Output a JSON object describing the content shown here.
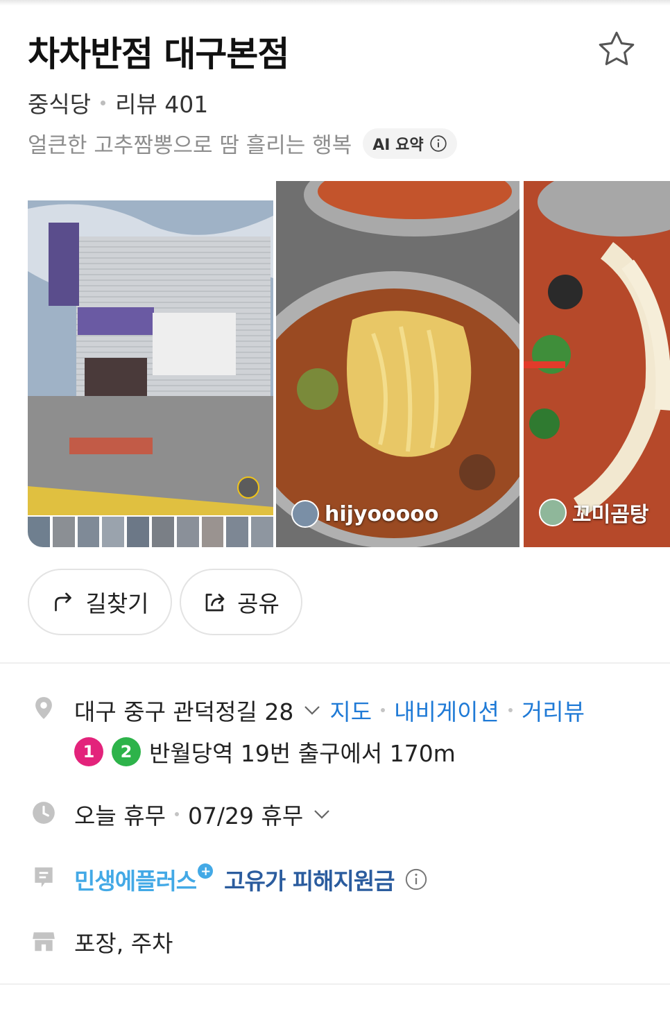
{
  "place": {
    "name": "차차반점 대구본점",
    "category": "중식당",
    "review_label": "리뷰 401",
    "summary": "얼큰한 고추짬뽕으로 땀 흘리는 행복",
    "ai_badge": "AI 요약"
  },
  "photos": [
    {
      "caption": "street-view",
      "credit": ""
    },
    {
      "caption": "food-photo",
      "credit": "hijyooooo"
    },
    {
      "caption": "food-photo",
      "credit": "꼬미곰탕"
    }
  ],
  "actions": {
    "directions_label": "길찾기",
    "share_label": "공유"
  },
  "address": {
    "text": "대구 중구 관덕정길 28",
    "map_link": "지도",
    "navigation_link": "내비게이션",
    "streetview_link": "거리뷰"
  },
  "subway": {
    "lines": [
      {
        "label": "1",
        "color": "#e3237b"
      },
      {
        "label": "2",
        "color": "#2db34a"
      }
    ],
    "text": "반월당역 19번 출구에서 170m"
  },
  "hours": {
    "status": "오늘 휴무",
    "detail": "07/29 휴무"
  },
  "promotion": {
    "brand": "민생에플러스",
    "plus_symbol": "+",
    "text": "고유가 피해지원금"
  },
  "amenities": "포장, 주차",
  "icons": [
    "star-icon",
    "info-icon",
    "directions-icon",
    "share-icon",
    "location-pin-icon",
    "chevron-down-icon",
    "clock-icon",
    "memo-icon",
    "store-icon"
  ]
}
